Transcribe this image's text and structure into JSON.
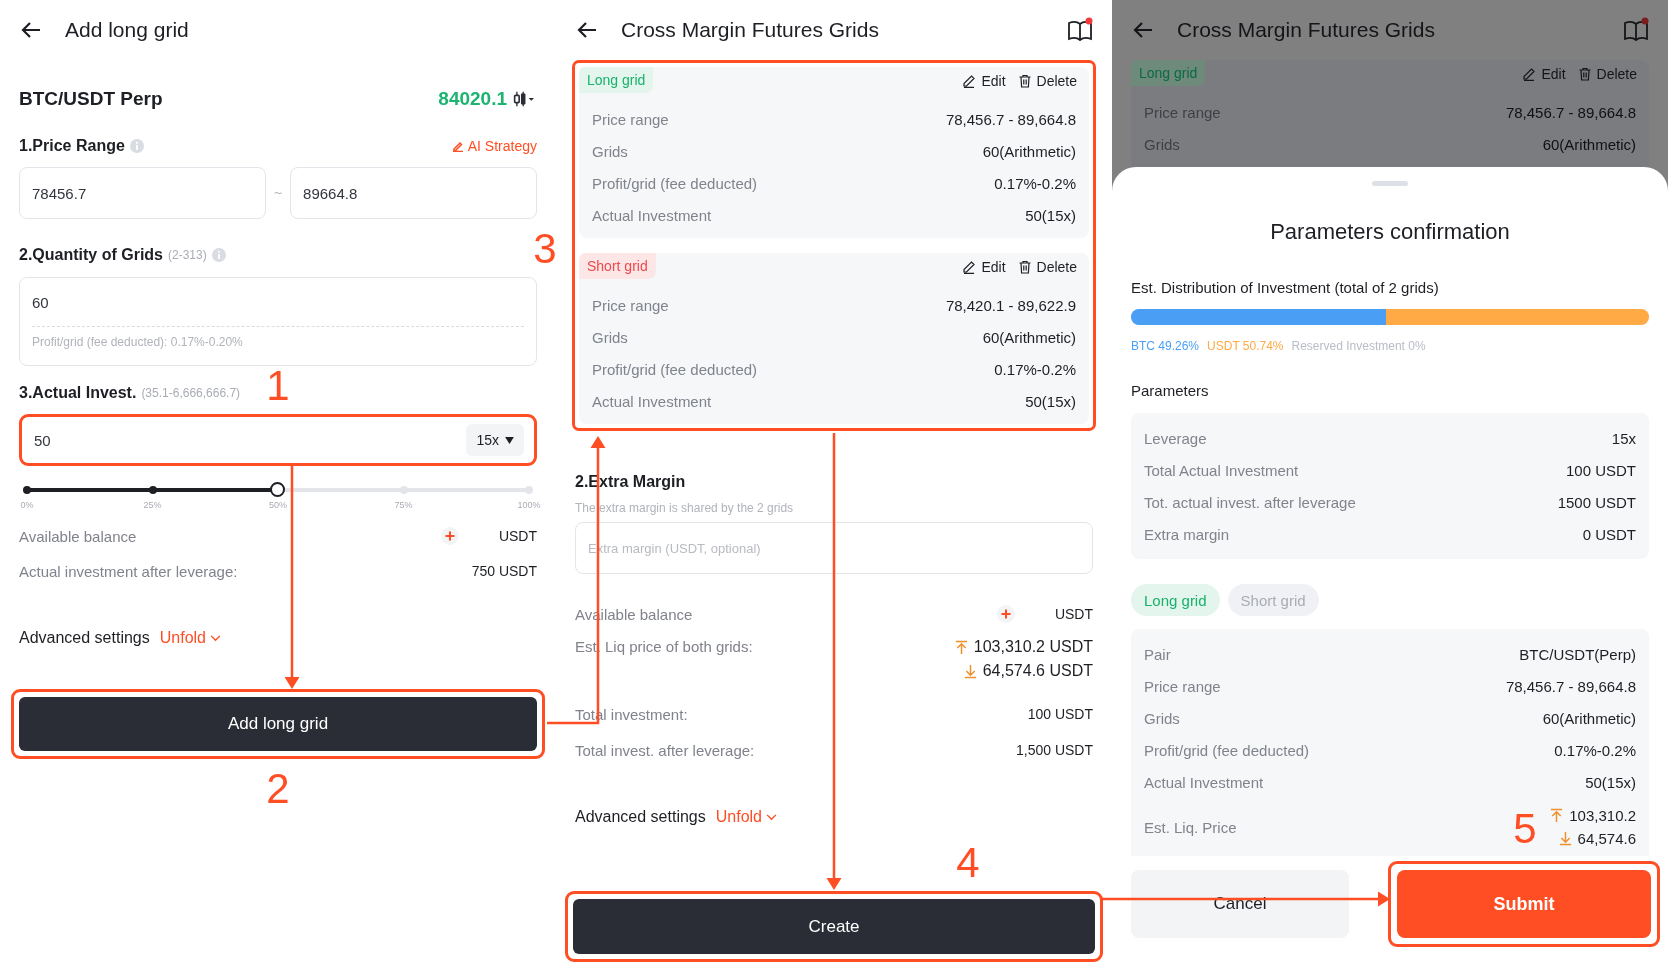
{
  "add_long_grid_screen": {
    "title": "Add long grid",
    "pair": "BTC/USDT Perp",
    "price": "84020.1",
    "price_range": {
      "label": "1.Price Range",
      "ai_strategy": "AI Strategy",
      "min": "78456.7",
      "separator": "~",
      "max": "89664.8"
    },
    "grids": {
      "label": "2.Quantity of Grids",
      "hint": "(2-313)",
      "value": "60",
      "profit": "Profit/grid (fee deducted): 0.17%-0.20%"
    },
    "invest": {
      "label": "3.Actual Invest.",
      "hint": "(35.1-6,666,666.7)",
      "value": "50",
      "leverage": "15x"
    },
    "slider": {
      "level": 0.5,
      "ticks": [
        "0%",
        "25%",
        "50%",
        "75%",
        "100%"
      ]
    },
    "rows": [
      {
        "kind": "balance",
        "label": "Available balance",
        "value": "USDT"
      },
      {
        "kind": "plain",
        "label": "Actual investment after leverage:",
        "value": "750 USDT"
      }
    ],
    "advanced": {
      "label": "Advanced settings",
      "toggle": "Unfold"
    },
    "button": "Add long grid"
  },
  "grids_screen": {
    "title": "Cross Margin Futures Grids",
    "grids": [
      {
        "kind": "long",
        "tag": "Long grid",
        "edit": "Edit",
        "delete": "Delete",
        "rows": [
          {
            "label": "Price range",
            "value": "78,456.7 - 89,664.8"
          },
          {
            "label": "Grids",
            "value": "60(Arithmetic)"
          },
          {
            "label": "Profit/grid (fee deducted)",
            "value": "0.17%-0.2%"
          },
          {
            "label": "Actual Investment",
            "value": "50(15x)"
          }
        ]
      },
      {
        "kind": "short",
        "tag": "Short grid",
        "edit": "Edit",
        "delete": "Delete",
        "rows": [
          {
            "label": "Price range",
            "value": "78,420.1 - 89,622.9"
          },
          {
            "label": "Grids",
            "value": "60(Arithmetic)"
          },
          {
            "label": "Profit/grid (fee deducted)",
            "value": "0.17%-0.2%"
          },
          {
            "label": "Actual Investment",
            "value": "50(15x)"
          }
        ]
      }
    ],
    "extra_margin": {
      "label": "2.Extra Margin",
      "note": "The extra margin is shared by the 2 grids",
      "placeholder": "Extra margin (USDT, optional)"
    },
    "rows": [
      {
        "kind": "balance",
        "label": "Available balance",
        "value": "USDT"
      },
      {
        "kind": "liq",
        "label": "Est. Liq price of both grids:",
        "up": "103,310.2 USDT",
        "down": "64,574.6 USDT"
      },
      {
        "kind": "plain",
        "label": "Total investment:",
        "value": "100 USDT"
      },
      {
        "kind": "plain",
        "label": "Total invest. after leverage:",
        "value": "1,500 USDT"
      }
    ],
    "advanced": {
      "label": "Advanced settings",
      "toggle": "Unfold"
    },
    "button": "Create"
  },
  "confirmation_screen": {
    "background": {
      "title": "Cross Margin Futures Grids",
      "tag": "Long grid",
      "edit": "Edit",
      "delete": "Delete",
      "rows": [
        {
          "label": "Price range",
          "value": "78,456.7 - 89,664.8"
        },
        {
          "label": "Grids",
          "value": "60(Arithmetic)"
        }
      ]
    },
    "sheet": {
      "title": "Parameters confirmation",
      "distribution_label": "Est. Distribution of Investment (total of 2 grids)",
      "segments": [
        {
          "label": "BTC 49.26%",
          "level": 0.4926,
          "color": "#4a9ff5"
        },
        {
          "label": "USDT 50.74%",
          "level": 0.5074,
          "color": "#ffaa44"
        },
        {
          "label": "Reserved Investment 0%",
          "color": "#b8bcc6"
        }
      ],
      "parameters_label": "Parameters",
      "parameters": [
        {
          "label": "Leverage",
          "value": "15x"
        },
        {
          "label": "Total Actual Investment",
          "value": "100 USDT"
        },
        {
          "label": "Tot. actual invest. after leverage",
          "value": "1500 USDT"
        },
        {
          "label": "Extra margin",
          "value": "0 USDT"
        }
      ],
      "tabs": [
        {
          "label": "Long grid",
          "selected": true
        },
        {
          "label": "Short grid",
          "selected": false
        }
      ],
      "details": [
        {
          "kind": "plain",
          "label": "Pair",
          "value": "BTC/USDT(Perp)"
        },
        {
          "kind": "plain",
          "label": "Price range",
          "value": "78,456.7 - 89,664.8"
        },
        {
          "kind": "plain",
          "label": "Grids",
          "value": "60(Arithmetic)"
        },
        {
          "kind": "plain",
          "label": "Profit/grid (fee deducted)",
          "value": "0.17%-0.2%"
        },
        {
          "kind": "plain",
          "label": "Actual Investment",
          "value": "50(15x)"
        },
        {
          "kind": "liq",
          "label": "Est. Liq. Price",
          "up": "103,310.2",
          "down": "64,574.6"
        }
      ],
      "cancel": "Cancel",
      "submit": "Submit"
    }
  },
  "steps": [
    "1",
    "2",
    "3",
    "4",
    "5"
  ]
}
